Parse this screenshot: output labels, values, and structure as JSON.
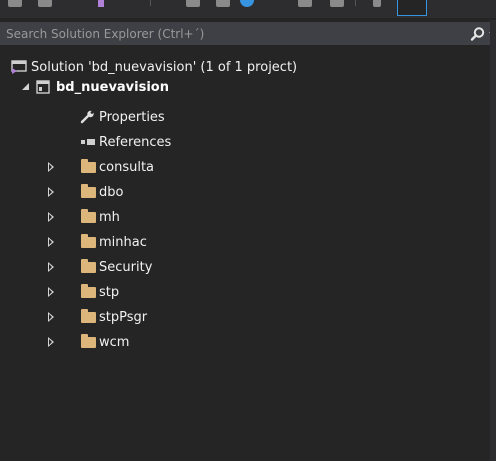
{
  "search": {
    "placeholder": "Search Solution Explorer (Ctrl+´)"
  },
  "tree": {
    "solution_label": "Solution 'bd_nuevavision' (1 of 1 project)",
    "project_label": "bd_nuevavision",
    "properties_label": "Properties",
    "references_label": "References",
    "folders": [
      "consulta",
      "dbo",
      "mh",
      "minhac",
      "Security",
      "stp",
      "stpPsgr",
      "wcm"
    ]
  },
  "colors": {
    "background": "#252526",
    "search_background": "#3f3f46",
    "folder": "#dcb67a",
    "text": "#f1f1f1",
    "placeholder_text": "#999999"
  },
  "icons": {
    "solution": "solution-icon",
    "project": "project-icon",
    "properties": "wrench-icon",
    "references": "references-icon",
    "folder": "folder-icon",
    "search": "search-icon"
  }
}
